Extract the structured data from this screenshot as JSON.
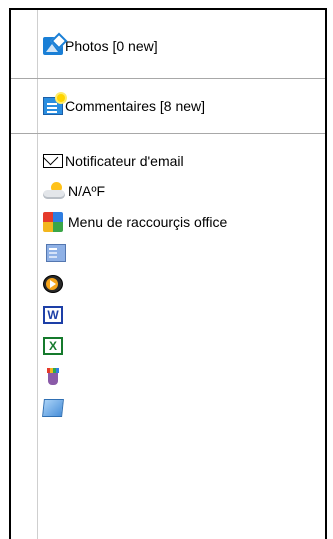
{
  "menu": {
    "photos": {
      "label": "Photos [0 new]",
      "icon": "photos-icon"
    },
    "comments": {
      "label": "Commentaires [8 new]",
      "icon": "comments-icon"
    },
    "email_notifier": {
      "label": "Notificateur d'email",
      "icon": "mail-icon"
    },
    "weather": {
      "label": "N/AºF",
      "icon": "weather-icon"
    },
    "office_shortcuts": {
      "label": "Menu de raccourçis office",
      "icon": "office-shortcuts-icon"
    },
    "shortcut_items": [
      {
        "icon": "calculator-icon"
      },
      {
        "icon": "media-player-icon"
      },
      {
        "icon": "word-icon",
        "glyph": "W"
      },
      {
        "icon": "excel-icon",
        "glyph": "X"
      },
      {
        "icon": "paint-icon"
      },
      {
        "icon": "notepad-icon"
      }
    ]
  },
  "colors": {
    "border": "#000000",
    "separator": "#a8a8a8"
  }
}
